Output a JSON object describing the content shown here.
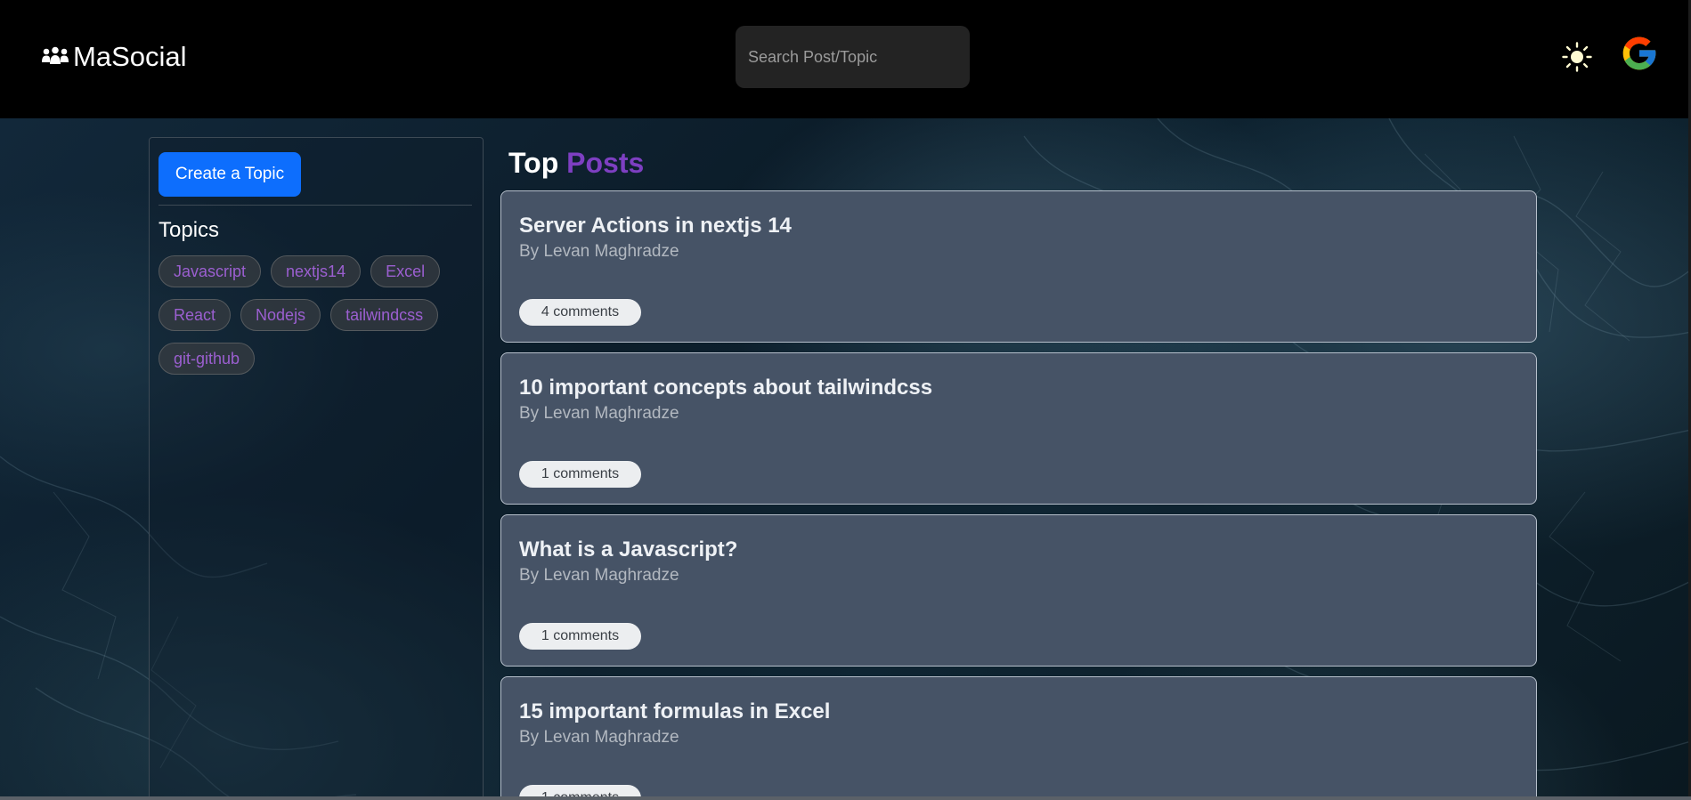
{
  "header": {
    "brand_name": "MaSocial",
    "brand_icon": "users-icon",
    "search": {
      "placeholder": "Search Post/Topic",
      "value": ""
    },
    "theme_icon": "sun-icon",
    "account_icon": "google-icon"
  },
  "sidebar": {
    "create_label": "Create a Topic",
    "topics_heading": "Topics",
    "topics": [
      "Javascript",
      "nextjs14",
      "Excel",
      "React",
      "Nodejs",
      "tailwindcss",
      "git-github"
    ]
  },
  "main": {
    "heading_first": "Top",
    "heading_accent": "Posts",
    "posts": [
      {
        "title": "Server Actions in nextjs 14",
        "author": "By Levan Maghradze",
        "comments": "4 comments"
      },
      {
        "title": "10 important concepts about tailwindcss",
        "author": "By Levan Maghradze",
        "comments": "1 comments"
      },
      {
        "title": "What is a Javascript?",
        "author": "By Levan Maghradze",
        "comments": "1 comments"
      },
      {
        "title": "15 important formulas in Excel",
        "author": "By Levan Maghradze",
        "comments": "1 comments"
      }
    ]
  },
  "colors": {
    "accent_purple": "#7d3fc1",
    "primary_button": "#0d6efd",
    "card_background": "#465366"
  }
}
